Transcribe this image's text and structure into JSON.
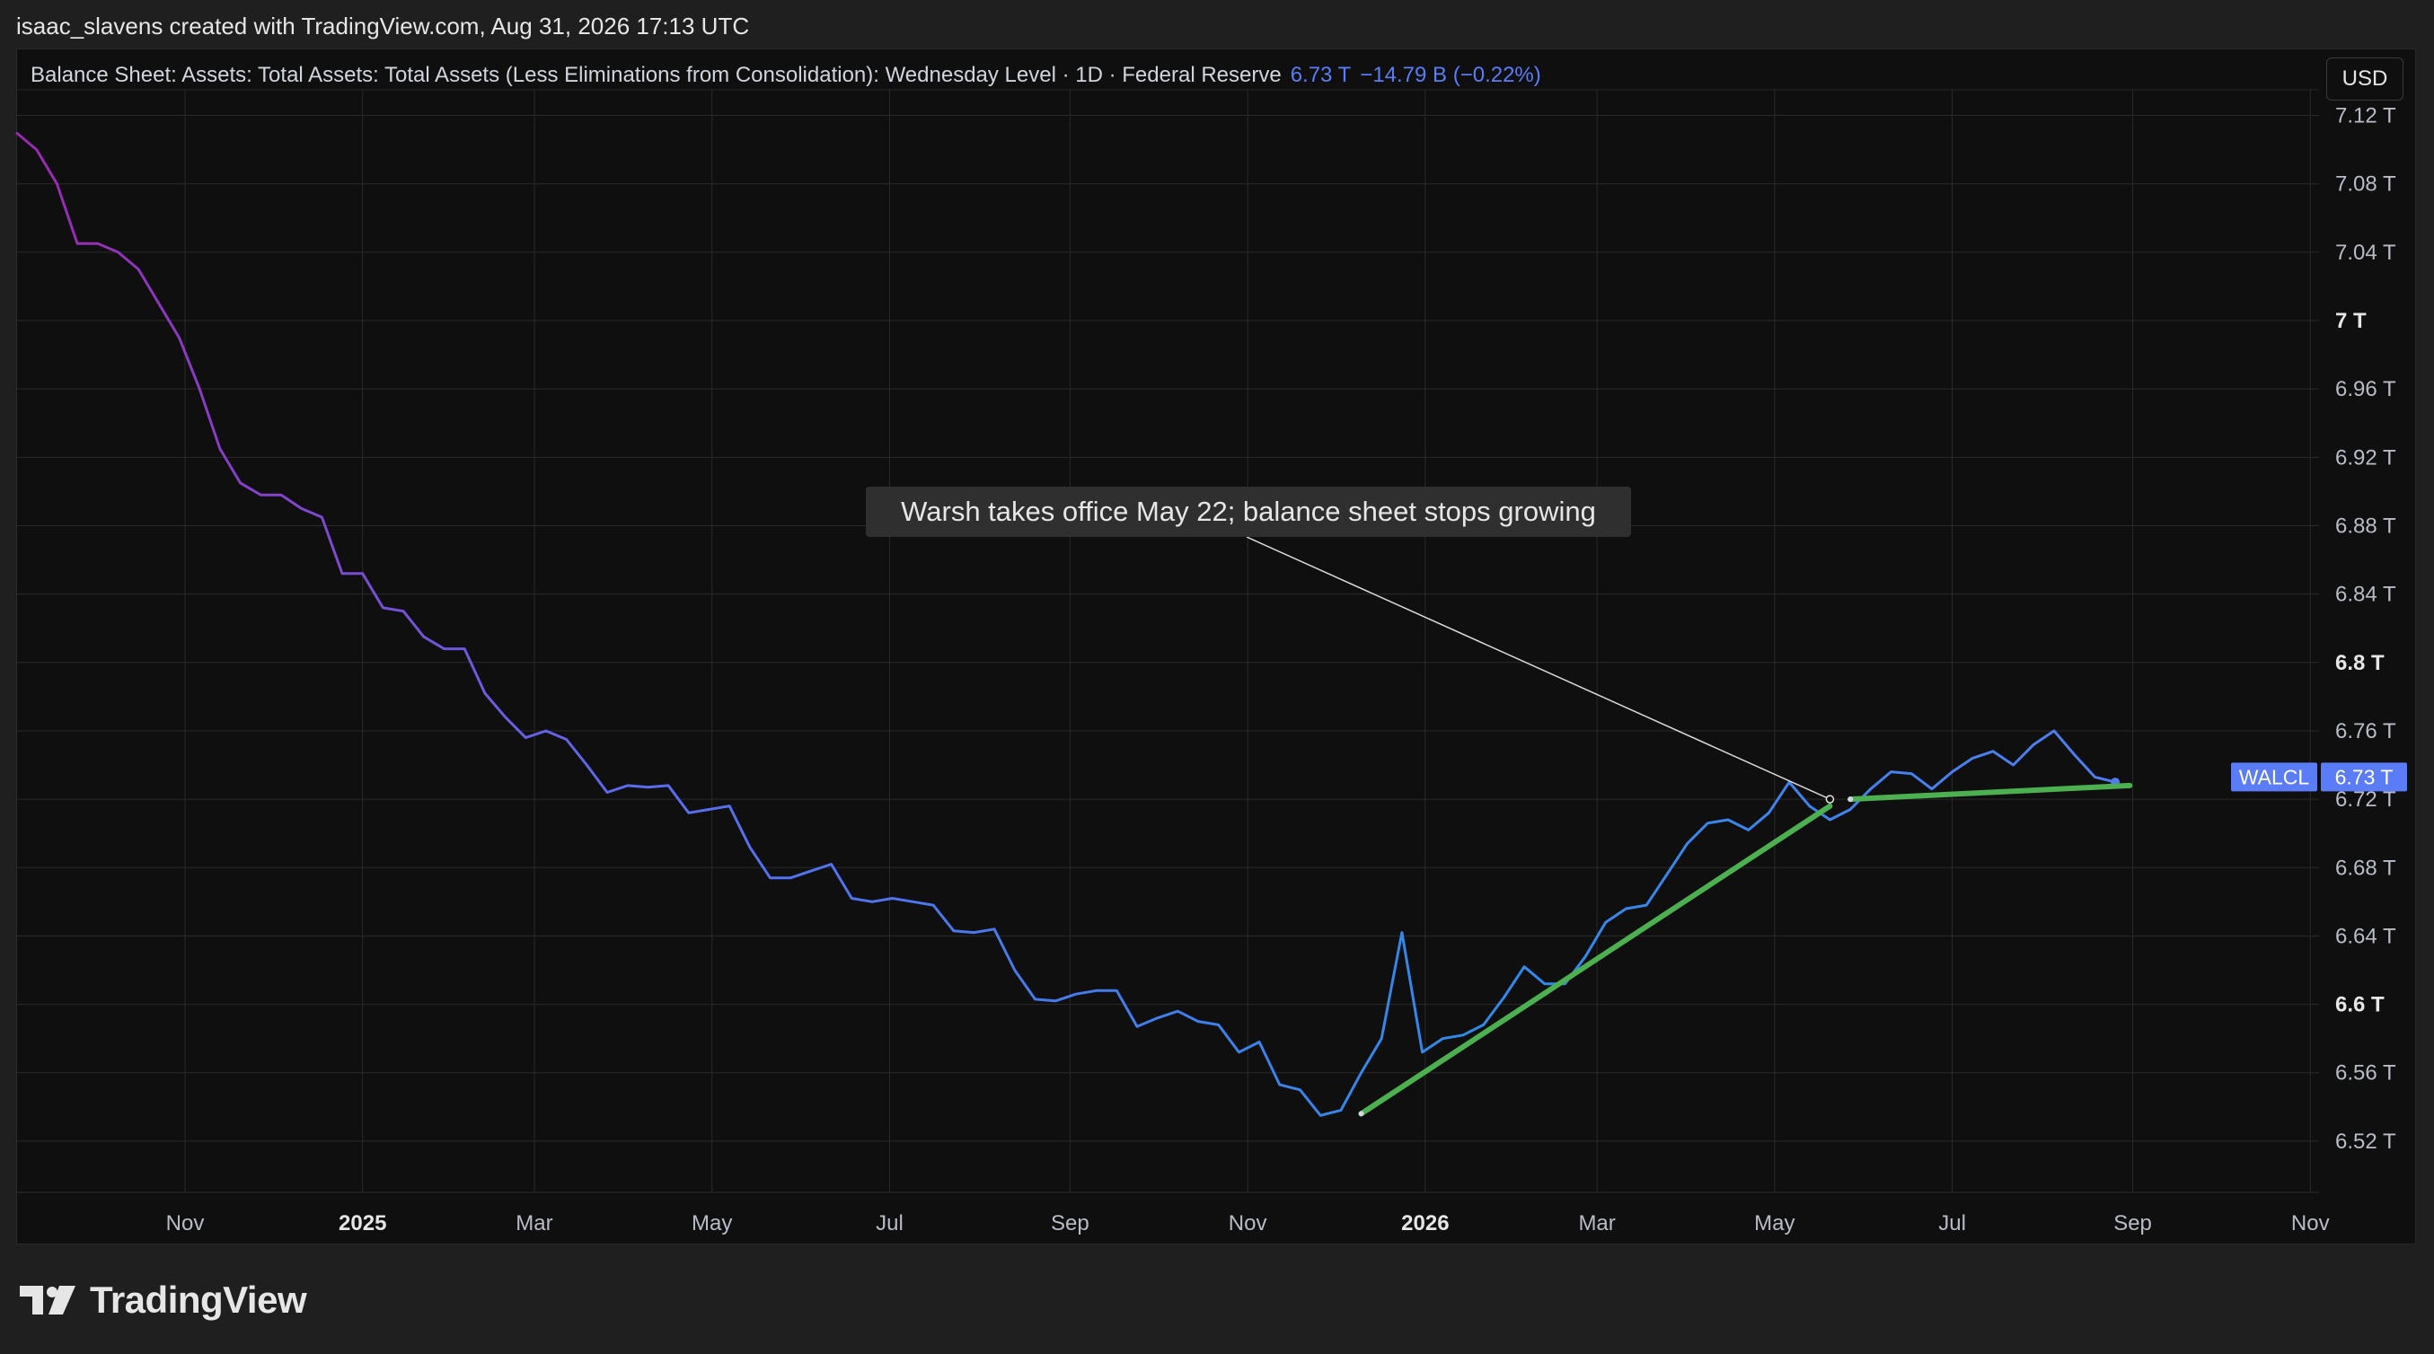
{
  "header": {
    "credit": "isaac_slavens created with TradingView.com, Aug 31, 2026 17:13 UTC"
  },
  "legend": {
    "title": "Balance Sheet: Assets: Total Assets: Total Assets (Less Eliminations from Consolidation): Wednesday Level · 1D · Federal Reserve",
    "value": "6.73 T",
    "change": "−14.79 B (−0.22%)"
  },
  "currency_button": "USD",
  "footer": {
    "brand": "TradingView"
  },
  "colors": {
    "line_early": "#9c27b0",
    "line_mid": "#5b6cf0",
    "line_late": "#2f8ae8",
    "trend": "#4caf50",
    "tag_bg": "#5b7cf7"
  },
  "chart_data": {
    "type": "line",
    "series": [
      {
        "name": "WALCL",
        "x": [
          "2024-09-04",
          "2024-09-11",
          "2024-09-18",
          "2024-09-25",
          "2024-10-02",
          "2024-10-09",
          "2024-10-16",
          "2024-10-23",
          "2024-10-30",
          "2024-11-06",
          "2024-11-13",
          "2024-11-20",
          "2024-11-27",
          "2024-12-04",
          "2024-12-11",
          "2024-12-18",
          "2024-12-25",
          "2025-01-01",
          "2025-01-08",
          "2025-01-15",
          "2025-01-22",
          "2025-01-29",
          "2025-02-05",
          "2025-02-12",
          "2025-02-19",
          "2025-02-26",
          "2025-03-05",
          "2025-03-12",
          "2025-03-19",
          "2025-03-26",
          "2025-04-02",
          "2025-04-09",
          "2025-04-16",
          "2025-04-23",
          "2025-04-30",
          "2025-05-07",
          "2025-05-14",
          "2025-05-21",
          "2025-05-28",
          "2025-06-04",
          "2025-06-11",
          "2025-06-18",
          "2025-06-25",
          "2025-07-02",
          "2025-07-09",
          "2025-07-16",
          "2025-07-23",
          "2025-07-30",
          "2025-08-06",
          "2025-08-13",
          "2025-08-20",
          "2025-08-27",
          "2025-09-03",
          "2025-09-10",
          "2025-09-17",
          "2025-09-24",
          "2025-10-01",
          "2025-10-08",
          "2025-10-15",
          "2025-10-22",
          "2025-10-29",
          "2025-11-05",
          "2025-11-12",
          "2025-11-19",
          "2025-11-26",
          "2025-12-03",
          "2025-12-10",
          "2025-12-17",
          "2025-12-24",
          "2025-12-31",
          "2026-01-07",
          "2026-01-14",
          "2026-01-21",
          "2026-01-28",
          "2026-02-04",
          "2026-02-11",
          "2026-02-18",
          "2026-02-25",
          "2026-03-04",
          "2026-03-11",
          "2026-03-18",
          "2026-03-25",
          "2026-04-01",
          "2026-04-08",
          "2026-04-15",
          "2026-04-22",
          "2026-04-29",
          "2026-05-06",
          "2026-05-13",
          "2026-05-20",
          "2026-05-27",
          "2026-06-03",
          "2026-06-10",
          "2026-06-17",
          "2026-06-24",
          "2026-07-01",
          "2026-07-08",
          "2026-07-15",
          "2026-07-22",
          "2026-07-29",
          "2026-08-05",
          "2026-08-12",
          "2026-08-19",
          "2026-08-26"
        ],
        "y": [
          7.11,
          7.1,
          7.08,
          7.045,
          7.045,
          7.04,
          7.03,
          7.01,
          6.99,
          6.96,
          6.925,
          6.905,
          6.898,
          6.898,
          6.89,
          6.885,
          6.852,
          6.852,
          6.832,
          6.83,
          6.815,
          6.808,
          6.808,
          6.782,
          6.768,
          6.756,
          6.76,
          6.755,
          6.74,
          6.724,
          6.728,
          6.727,
          6.728,
          6.712,
          6.714,
          6.716,
          6.692,
          6.674,
          6.674,
          6.678,
          6.682,
          6.662,
          6.66,
          6.662,
          6.66,
          6.658,
          6.643,
          6.642,
          6.644,
          6.62,
          6.603,
          6.602,
          6.606,
          6.608,
          6.608,
          6.587,
          6.592,
          6.596,
          6.59,
          6.588,
          6.572,
          6.578,
          6.553,
          6.55,
          6.535,
          6.538,
          6.56,
          6.58,
          6.642,
          6.572,
          6.58,
          6.582,
          6.588,
          6.604,
          6.622,
          6.612,
          6.612,
          6.628,
          6.648,
          6.656,
          6.658,
          6.676,
          6.694,
          6.706,
          6.708,
          6.702,
          6.712,
          6.73,
          6.716,
          6.708,
          6.714,
          6.726,
          6.736,
          6.735,
          6.726,
          6.736,
          6.744,
          6.748,
          6.74,
          6.752,
          6.76,
          6.746,
          6.733,
          6.73
        ]
      }
    ],
    "trendlines": [
      {
        "from": {
          "x": "2025-12-10",
          "y": 6.536
        },
        "to": {
          "x": "2026-05-20",
          "y": 6.716
        }
      },
      {
        "from": {
          "x": "2026-05-27",
          "y": 6.72
        },
        "to": {
          "x": "2026-08-31",
          "y": 6.728
        }
      }
    ],
    "annotation": {
      "text": "Warsh takes office May 22; balance sheet stops growing",
      "point": {
        "x": "2026-05-20",
        "y": 6.72
      }
    },
    "xlim": [
      "2024-09-04",
      "2026-11-04"
    ],
    "ylim": [
      6.48,
      7.16
    ],
    "x_ticks": [
      {
        "label": "Nov",
        "x": "2024-11-01",
        "bold": false
      },
      {
        "label": "2025",
        "x": "2025-01-01",
        "bold": true
      },
      {
        "label": "Mar",
        "x": "2025-03-01",
        "bold": false
      },
      {
        "label": "May",
        "x": "2025-05-01",
        "bold": false
      },
      {
        "label": "Jul",
        "x": "2025-07-01",
        "bold": false
      },
      {
        "label": "Sep",
        "x": "2025-09-01",
        "bold": false
      },
      {
        "label": "Nov",
        "x": "2025-11-01",
        "bold": false
      },
      {
        "label": "2026",
        "x": "2026-01-01",
        "bold": true
      },
      {
        "label": "Mar",
        "x": "2026-03-01",
        "bold": false
      },
      {
        "label": "May",
        "x": "2026-05-01",
        "bold": false
      },
      {
        "label": "Jul",
        "x": "2026-07-01",
        "bold": false
      },
      {
        "label": "Sep",
        "x": "2026-09-01",
        "bold": false
      },
      {
        "label": "Nov",
        "x": "2026-11-01",
        "bold": false
      }
    ],
    "y_ticks": [
      {
        "label": "7.12 T",
        "y": 7.12,
        "bold": false
      },
      {
        "label": "7.08 T",
        "y": 7.08,
        "bold": false
      },
      {
        "label": "7.04 T",
        "y": 7.04,
        "bold": false
      },
      {
        "label": "7 T",
        "y": 7.0,
        "bold": true
      },
      {
        "label": "6.96 T",
        "y": 6.96,
        "bold": false
      },
      {
        "label": "6.92 T",
        "y": 6.92,
        "bold": false
      },
      {
        "label": "6.88 T",
        "y": 6.88,
        "bold": false
      },
      {
        "label": "6.84 T",
        "y": 6.84,
        "bold": false
      },
      {
        "label": "6.8 T",
        "y": 6.8,
        "bold": true
      },
      {
        "label": "6.76 T",
        "y": 6.76,
        "bold": false
      },
      {
        "label": "6.72 T",
        "y": 6.72,
        "bold": false
      },
      {
        "label": "6.68 T",
        "y": 6.68,
        "bold": false
      },
      {
        "label": "6.64 T",
        "y": 6.64,
        "bold": false
      },
      {
        "label": "6.6 T",
        "y": 6.6,
        "bold": true
      },
      {
        "label": "6.56 T",
        "y": 6.56,
        "bold": false
      },
      {
        "label": "6.52 T",
        "y": 6.52,
        "bold": false
      }
    ],
    "last_value_tag": {
      "name": "WALCL",
      "value": "6.73 T",
      "y": 6.733
    },
    "grid": true
  }
}
